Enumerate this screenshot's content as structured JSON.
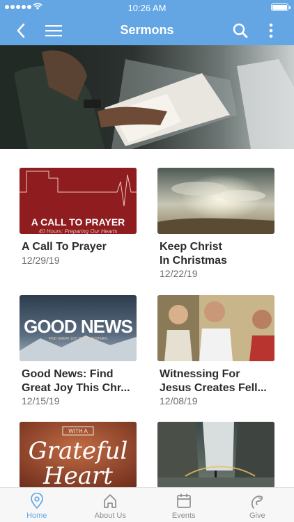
{
  "status_bar": {
    "time": "10:26 AM"
  },
  "header": {
    "title": "Sermons"
  },
  "sermons": [
    {
      "title": "A Call To Prayer",
      "date": "12/29/19",
      "art": {
        "headline": "A CALL TO PRAYER",
        "subline": "40 Hours: Preparing Our Hearts"
      }
    },
    {
      "title": "Keep Christ In Christmas",
      "date": "12/22/19"
    },
    {
      "title": "Good News: Find Great Joy This Chr...",
      "date": "12/15/19",
      "art": {
        "headline": "GOOD NEWS",
        "subline": "FIND GREAT JOY THIS CHRISTMAS"
      }
    },
    {
      "title": "Witnessing For Jesus Creates Fell...",
      "date": "12/08/19"
    },
    {
      "title": "",
      "date": "",
      "art": {
        "headline1": "Grateful",
        "headline2": "Heart",
        "small": "WITH A"
      }
    },
    {
      "title": "",
      "date": ""
    }
  ],
  "tabs": [
    {
      "label": "Home",
      "icon": "location-pin-icon",
      "active": true
    },
    {
      "label": "About Us",
      "icon": "home-icon",
      "active": false
    },
    {
      "label": "Events",
      "icon": "calendar-icon",
      "active": false
    },
    {
      "label": "Give",
      "icon": "give-icon",
      "active": false
    }
  ],
  "colors": {
    "accent": "#64a6e3",
    "tab_inactive": "#8e8e93"
  }
}
